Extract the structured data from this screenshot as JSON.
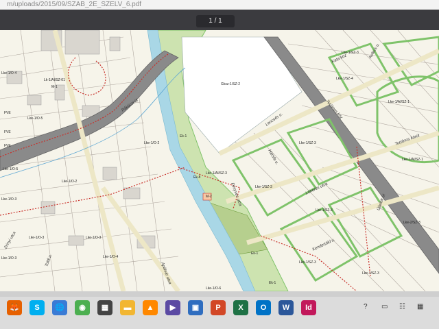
{
  "viewer": {
    "url": "m/uploads/2015/09/SZAB_2E_SZELV_6.pdf",
    "page_indicator": "1 / 1"
  },
  "map": {
    "colors": {
      "background": "#f6f4ea",
      "road": "#8a8a8a",
      "road_edge": "#666666",
      "green_zone": "#cde3b0",
      "green_border": "#7fc36a",
      "water_blue": "#a9d7e6",
      "parcel_line": "#b0a8a0",
      "boundary_red": "#c8302a",
      "building": "#d9d6cf"
    },
    "labels": {
      "zone_lke_1_ai_sz_01": "Lk-1/AI/SZ-01",
      "zone_m1": "M-1",
      "street_rakoczi": "Rákóczi út",
      "zone_lke_1_o_4": "Lke-1/O-4",
      "zone_lke_1_o_5": "Lke-1/O-5",
      "zone_lke_1_o_5b": "Lke-1/O-5",
      "zone_lke_1_o_2": "Lke-1/O-2",
      "zone_lke_1_o_2b": "Lke-1/O-2",
      "zone_lke_1_o_3": "Lke-1/O-3",
      "zone_lke_1_o_3b": "Lke-1/O-3",
      "zone_lke_1_o_3c": "Lke-1/O-3",
      "zone_lke_1_o_4b": "Lke-1/O-4",
      "zone_lke_1_o_6": "Lke-1/O-6",
      "zone_ek_1a": "Ek-1",
      "zone_ek_1b": "Ek-1",
      "zone_ek_1c": "Ek-1",
      "zone_ek_8": "Ek-8",
      "zone_gksz_1_sz_2": "Gksz-1/SZ-2",
      "zone_lke_1_ai_sz_3": "Lke-1/AI/SZ-3",
      "zone_lke_1_sz_3a": "Lke-1/SZ-3",
      "zone_lke_1_sz_3b": "Lke-1/SZ-3",
      "zone_lke_1_sz_3c": "Lke-1/SZ-3",
      "zone_lke_1_sz_3d": "Lke-1/SZ-3",
      "zone_lke_1_sz_3e": "Lke-1/SZ-3",
      "zone_lke_1_sz_4": "Lke-1/SZ-4",
      "zone_lke_1_sz_1": "Lke-1/AI/SZ-1",
      "zone_lke_1_sz_3f": "Lke-1/SZ-3",
      "zone_lke_1_ai_sz_1b": "Lke-1/AI/SZ-1",
      "zone_lke_1_sz_3g": "Lke-1/SZ-3",
      "zone_m2": "M-2",
      "zone_fve_a": "FVE",
      "zone_fve_b": "FVE",
      "zone_fve_c": "FVE",
      "street_kata_koz": "Kata köz",
      "street_kelecs": "Kelecs u.",
      "street_turjanos_koz": "Turjános köz",
      "street_turjanos_korut": "Turjános körút",
      "street_lencsehaz": "Lencsés u.",
      "street_harsfa": "Hársfa u.",
      "street_fenyves": "Fenyves utca",
      "street_loherete": "Lóherés utca",
      "street_kendertold": "Kendertöld u.",
      "street_ujtelek": "Újtelek út",
      "street_apatvar": "Apátvár utca",
      "street_zrinyi": "Zrínyi utca",
      "street_toldi": "Toldi u.",
      "zone_lke_2_sz_3": "Lke-2/SZ-3",
      "zone_lke_1_o_3d": "Lke-1/O-3"
    }
  },
  "taskbar": {
    "apps": [
      {
        "icon": "firefox-icon",
        "glyph": "🦊",
        "color": "#e66000"
      },
      {
        "icon": "skype-icon",
        "glyph": "S",
        "color": "#00aff0"
      },
      {
        "icon": "globe-icon",
        "glyph": "🌐",
        "color": "#3a7bd5"
      },
      {
        "icon": "chrome-icon",
        "glyph": "◉",
        "color": "#4caf50"
      },
      {
        "icon": "media-icon",
        "glyph": "▦",
        "color": "#444444"
      },
      {
        "icon": "folder-icon",
        "glyph": "▬",
        "color": "#f2b632"
      },
      {
        "icon": "vlc-icon",
        "glyph": "▲",
        "color": "#ff8800"
      },
      {
        "icon": "play-icon",
        "glyph": "▶",
        "color": "#5b4aa3"
      },
      {
        "icon": "save-icon",
        "glyph": "▣",
        "color": "#2f6dbf"
      },
      {
        "icon": "powerpoint-icon",
        "glyph": "P",
        "color": "#d24726"
      },
      {
        "icon": "excel-icon",
        "glyph": "X",
        "color": "#1e7145"
      },
      {
        "icon": "outlook-icon",
        "glyph": "O",
        "color": "#0072c6"
      },
      {
        "icon": "word-icon",
        "glyph": "W",
        "color": "#2b579a"
      },
      {
        "icon": "indesign-icon",
        "glyph": "Id",
        "color": "#c2185b"
      }
    ],
    "tray": [
      {
        "icon": "help-icon",
        "glyph": "?"
      },
      {
        "icon": "monitor-icon",
        "glyph": "▭"
      },
      {
        "icon": "chat-icon",
        "glyph": "☷"
      },
      {
        "icon": "network-icon",
        "glyph": "▦"
      }
    ]
  }
}
